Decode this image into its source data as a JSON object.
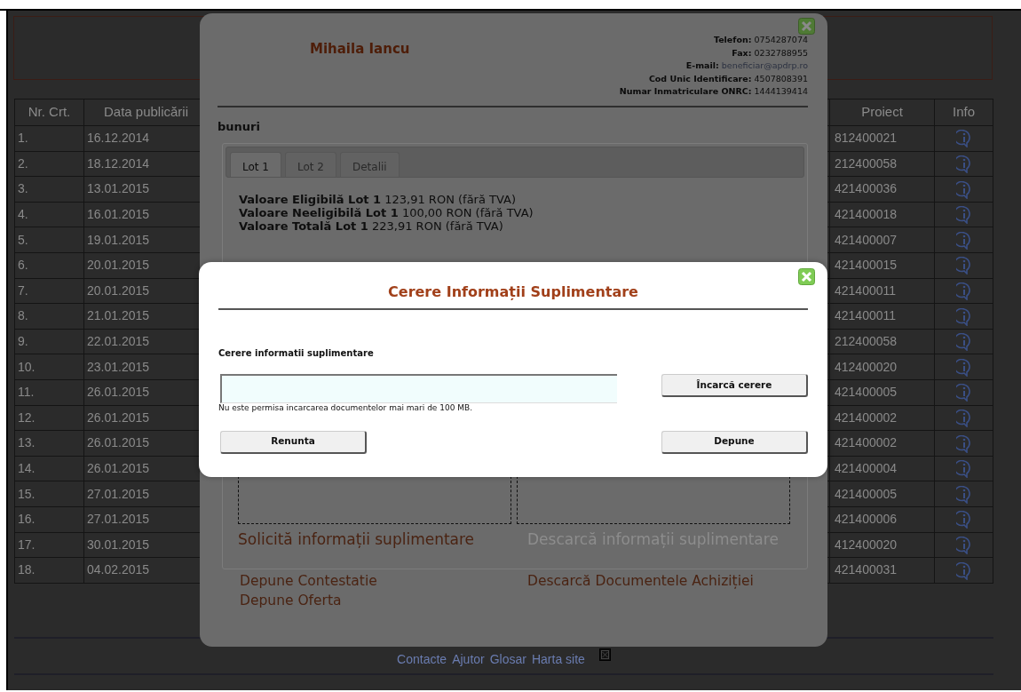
{
  "page": {
    "table": {
      "columns": [
        "Nr. Crt.",
        "Data publicării",
        "Proiect",
        "Info"
      ],
      "rows": [
        {
          "nr": "1.",
          "date": "16.12.2014",
          "project": "812400021"
        },
        {
          "nr": "2.",
          "date": "18.12.2014",
          "project": "212400058"
        },
        {
          "nr": "3.",
          "date": "13.01.2015",
          "project": "421400036"
        },
        {
          "nr": "4.",
          "date": "16.01.2015",
          "project": "421400018"
        },
        {
          "nr": "5.",
          "date": "19.01.2015",
          "project": "421400007"
        },
        {
          "nr": "6.",
          "date": "20.01.2015",
          "project": "421400015"
        },
        {
          "nr": "7.",
          "date": "20.01.2015",
          "project": "421400011"
        },
        {
          "nr": "8.",
          "date": "21.01.2015",
          "project": "421400011"
        },
        {
          "nr": "9.",
          "date": "22.01.2015",
          "project": "212400058"
        },
        {
          "nr": "10.",
          "date": "23.01.2015",
          "project": "412400020"
        },
        {
          "nr": "11.",
          "date": "26.01.2015",
          "project": "421400005"
        },
        {
          "nr": "12.",
          "date": "26.01.2015",
          "project": "421400002"
        },
        {
          "nr": "13.",
          "date": "26.01.2015",
          "project": "421400002"
        },
        {
          "nr": "14.",
          "date": "26.01.2015",
          "project": "421400004"
        },
        {
          "nr": "15.",
          "date": "27.01.2015",
          "project": "421400005"
        },
        {
          "nr": "16.",
          "date": "27.01.2015",
          "project": "421400006"
        },
        {
          "nr": "17.",
          "date": "30.01.2015",
          "project": "412400020"
        },
        {
          "nr": "18.",
          "date": "04.02.2015",
          "project": "421400031"
        }
      ]
    },
    "footer_links": [
      "Contacte",
      "Ajutor",
      "Glosar",
      "Harta site"
    ]
  },
  "details_dialog": {
    "name": "Mihaila Iancu",
    "contact": [
      {
        "label": "Telefon:",
        "value": "0754287074",
        "kind": "text"
      },
      {
        "label": "Fax:",
        "value": "0232788955",
        "kind": "text"
      },
      {
        "label": "E-mail:",
        "value": "beneficiar@apdrp.ro",
        "kind": "link"
      },
      {
        "label": "Cod Unic Identificare:",
        "value": "4507808391",
        "kind": "text"
      },
      {
        "label": "Numar Inmatriculare ONRC:",
        "value": "1444139414",
        "kind": "text"
      }
    ],
    "category": "bunuri",
    "tabs": [
      {
        "label": "Lot 1",
        "selected": true
      },
      {
        "label": "Lot 2",
        "selected": false
      },
      {
        "label": "Detalii",
        "selected": false
      }
    ],
    "values": [
      {
        "label": "Valoare Eligibilă Lot 1",
        "value": "123,91 RON (fără TVA)"
      },
      {
        "label": "Valoare Neeligibilă Lot 1",
        "value": "100,00 RON (fără TVA)"
      },
      {
        "label": "Valoare Totală Lot 1",
        "value": "223,91 RON (fără TVA)"
      }
    ],
    "actions": [
      {
        "label": "Solicită informații suplimentare",
        "disabled": false
      },
      {
        "label": "Descarcă informații suplimentare",
        "disabled": true
      }
    ],
    "left_links": [
      "Depune Contestatie",
      "Depune Oferta"
    ],
    "right_links": [
      "Descarcă Documentele Achiziției"
    ]
  },
  "request_dialog": {
    "title": "Cerere Informații Suplimentare",
    "field_label": "Cerere informatii suplimentare",
    "upload_button": "Încarcă cerere",
    "hint": "Nu este permisa incarcarea documentelor mai mari de 100 MB.",
    "cancel_button": "Renunta",
    "submit_button": "Depune"
  }
}
